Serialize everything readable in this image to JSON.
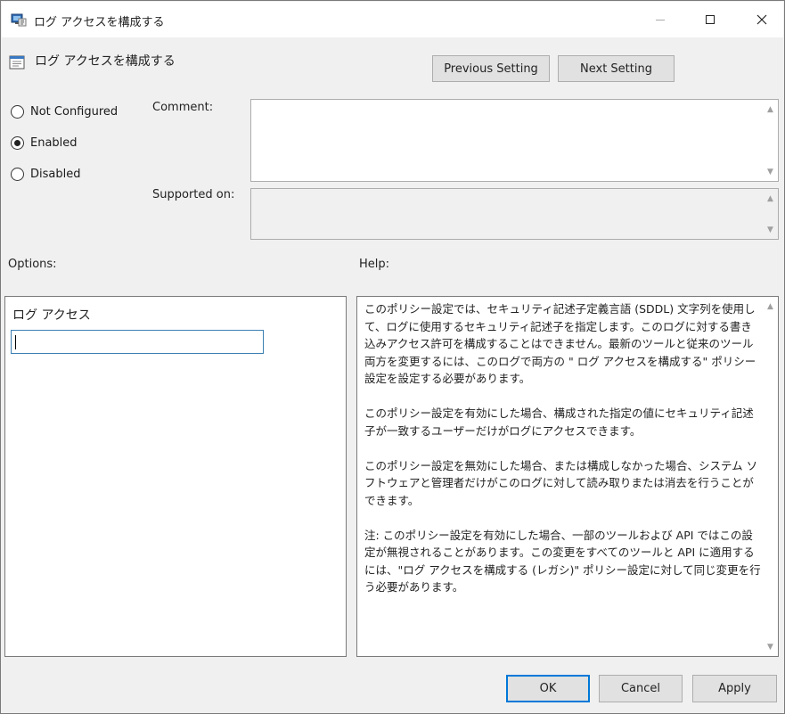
{
  "window": {
    "title": "ログ アクセスを構成する",
    "icons": {
      "app": "policy-app-icon",
      "minimize": "minimize-icon",
      "maximize": "maximize-icon",
      "close": "close-icon"
    }
  },
  "header": {
    "title": "ログ アクセスを構成する",
    "icon": "policy-setting-icon",
    "prev_label": "Previous Setting",
    "next_label": "Next Setting"
  },
  "state": {
    "options": [
      {
        "label": "Not Configured",
        "selected": false
      },
      {
        "label": "Enabled",
        "selected": true
      },
      {
        "label": "Disabled",
        "selected": false
      }
    ]
  },
  "comment": {
    "label": "Comment:",
    "value": ""
  },
  "supported": {
    "label": "Supported on:",
    "value": ""
  },
  "options_panel": {
    "heading": "Options:",
    "field_label": "ログ アクセス",
    "field_value": ""
  },
  "help_panel": {
    "heading": "Help:",
    "paragraphs": [
      "このポリシー設定では、セキュリティ記述子定義言語 (SDDL) 文字列を使用して、ログに使用するセキュリティ記述子を指定します。このログに対する書き込みアクセス許可を構成することはできません。最新のツールと従来のツール両方を変更するには、このログで両方の \" ログ アクセスを構成する\" ポリシー設定を設定する必要があります。",
      "このポリシー設定を有効にした場合、構成された指定の値にセキュリティ記述子が一致するユーザーだけがログにアクセスできます。",
      "このポリシー設定を無効にした場合、または構成しなかった場合、システム ソフトウェアと管理者だけがこのログに対して読み取りまたは消去を行うことができます。",
      "注: このポリシー設定を有効にした場合、一部のツールおよび API ではこの設定が無視されることがあります。この変更をすべてのツールと API に適用するには、\"ログ アクセスを構成する (レガシ)\" ポリシー設定に対して同じ変更を行う必要があります。"
    ]
  },
  "footer": {
    "ok": "OK",
    "cancel": "Cancel",
    "apply": "Apply"
  },
  "colors": {
    "accent": "#0078d7",
    "dialog_bg": "#f0f0f0",
    "button_bg": "#e1e1e1"
  }
}
